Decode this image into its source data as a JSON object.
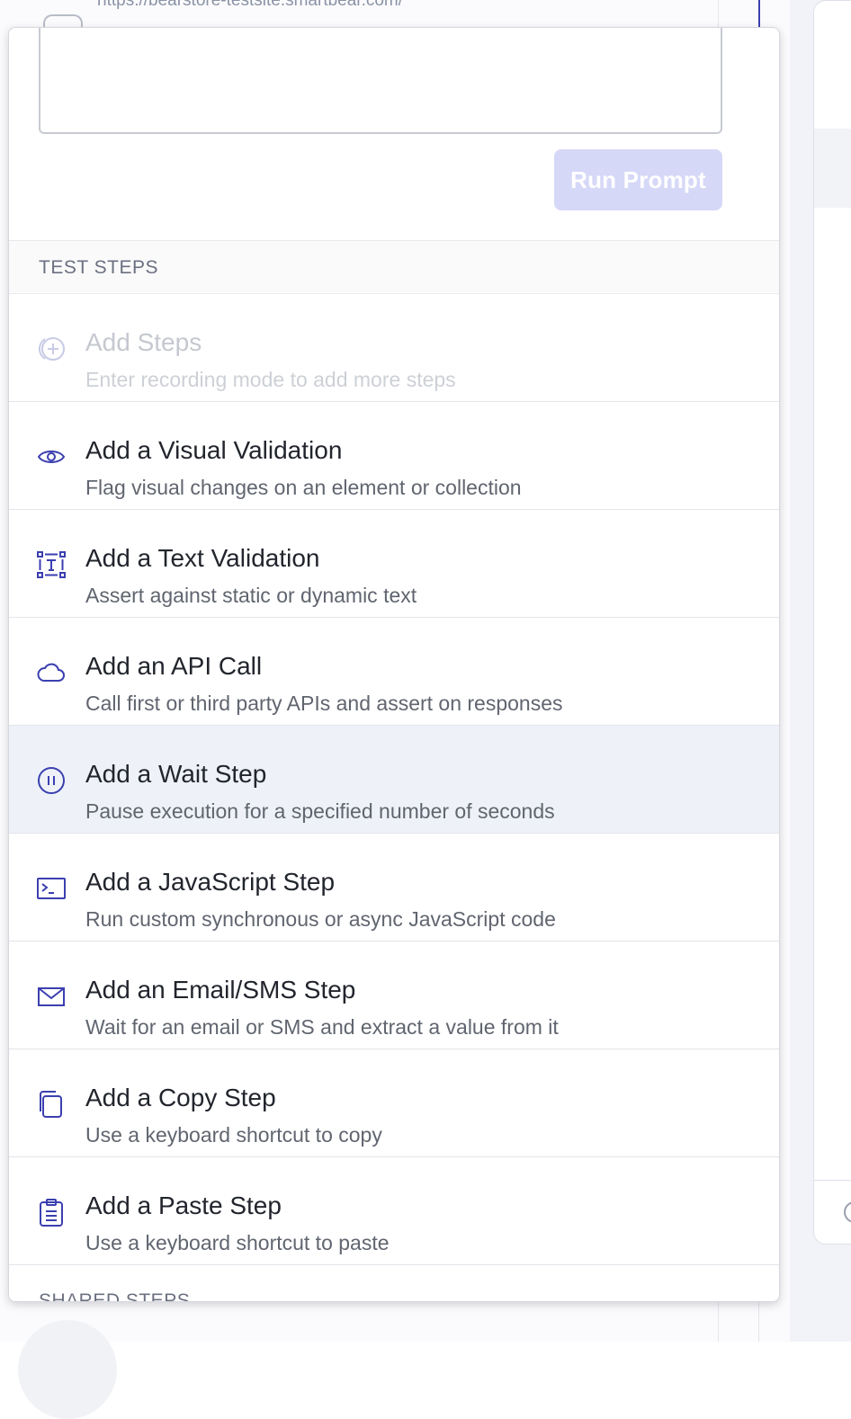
{
  "background": {
    "url": "https://bearstore-testsite.smartbear.com/"
  },
  "prompt": {
    "value": "",
    "run_button_label": "Run Prompt"
  },
  "test_steps": {
    "header": "TEST STEPS",
    "items": [
      {
        "title": "Add Steps",
        "description": "Enter recording mode to add more steps",
        "icon": "add-circle-icon",
        "disabled": true
      },
      {
        "title": "Add a Visual Validation",
        "description": "Flag visual changes on an element or collection",
        "icon": "eye-icon"
      },
      {
        "title": "Add a Text Validation",
        "description": "Assert against static or dynamic text",
        "icon": "text-select-icon"
      },
      {
        "title": "Add an API Call",
        "description": "Call first or third party APIs and assert on responses",
        "icon": "cloud-icon"
      },
      {
        "title": "Add a Wait Step",
        "description": "Pause execution for a specified number of seconds",
        "icon": "pause-circle-icon",
        "hovered": true
      },
      {
        "title": "Add a JavaScript Step",
        "description": "Run custom synchronous or async JavaScript code",
        "icon": "terminal-icon"
      },
      {
        "title": "Add an Email/SMS Step",
        "description": "Wait for an email or SMS and extract a value from it",
        "icon": "mail-icon"
      },
      {
        "title": "Add a Copy Step",
        "description": "Use a keyboard shortcut to copy",
        "icon": "copy-icon"
      },
      {
        "title": "Add a Paste Step",
        "description": "Use a keyboard shortcut to paste",
        "icon": "clipboard-icon"
      }
    ]
  },
  "shared_steps": {
    "header": "SHARED STEPS"
  },
  "colors": {
    "accent": "#3b3fb0",
    "run_button_disabled": "#d6d8f7",
    "hover_row": "#eef2f8"
  }
}
